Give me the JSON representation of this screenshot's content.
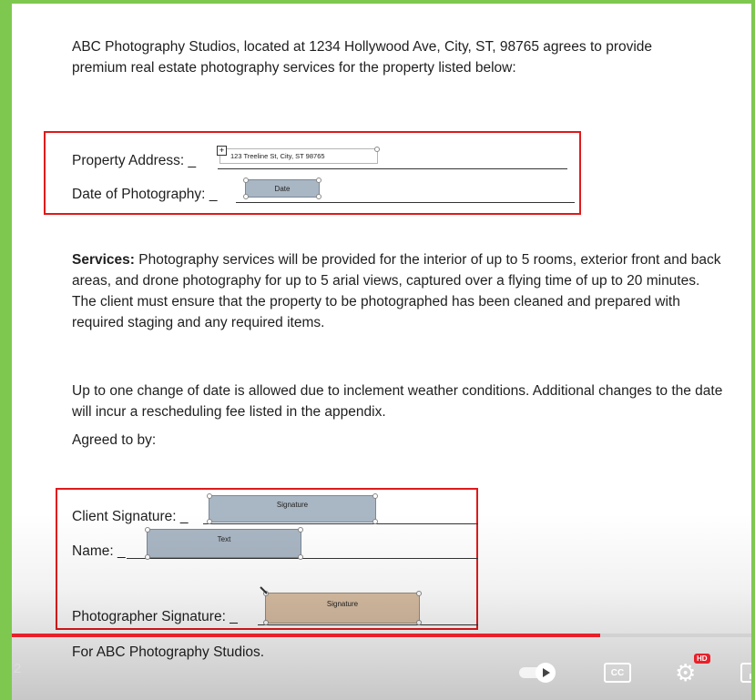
{
  "document": {
    "intro": "ABC Photography Studios, located at 1234 Hollywood Ave, City, ST, 98765 agrees to provide premium real estate photography services for the property listed below:",
    "property_address_label": "Property Address:",
    "property_address_prefix": "_",
    "property_address_value": "123 Treeline St, City, ST 98765",
    "date_label": "Date of Photography:",
    "date_prefix": "_",
    "date_field": "Date",
    "services_title": "Services:",
    "services_body": "Photography services will be provided for the interior of up to 5 rooms, exterior front and back areas, and drone photography for up to 5 arial views, captured over a flying time of up to 20 minutes. The client must ensure that the property to be photographed has been cleaned and prepared with required staging and any required items.",
    "weather_para": "Up to one change of date is allowed due to inclement weather conditions. Additional changes to the date will incur a rescheduling fee listed in the appendix.",
    "agreed": "Agreed to by:",
    "client_sig_label": "Client Signature:",
    "client_sig_prefix": "_",
    "client_sig_field": "Signature",
    "name_label": "Name:",
    "name_prefix": "_",
    "name_field": "Text",
    "photographer_sig_label": "Photographer Signature:",
    "photographer_sig_prefix": "_",
    "photographer_sig_field": "Signature",
    "for_line": "For ABC Photography Studios."
  },
  "player": {
    "time_fragment": "2",
    "progress_fraction": 0.795,
    "cc_label": "CC",
    "hd_badge": "HD",
    "colors": {
      "progress": "#e8202a",
      "frame": "#7ec850",
      "highlight": "#e0191b"
    },
    "icons": [
      "autoplay-toggle-icon",
      "captions-icon",
      "gear-icon",
      "miniplayer-icon"
    ]
  }
}
